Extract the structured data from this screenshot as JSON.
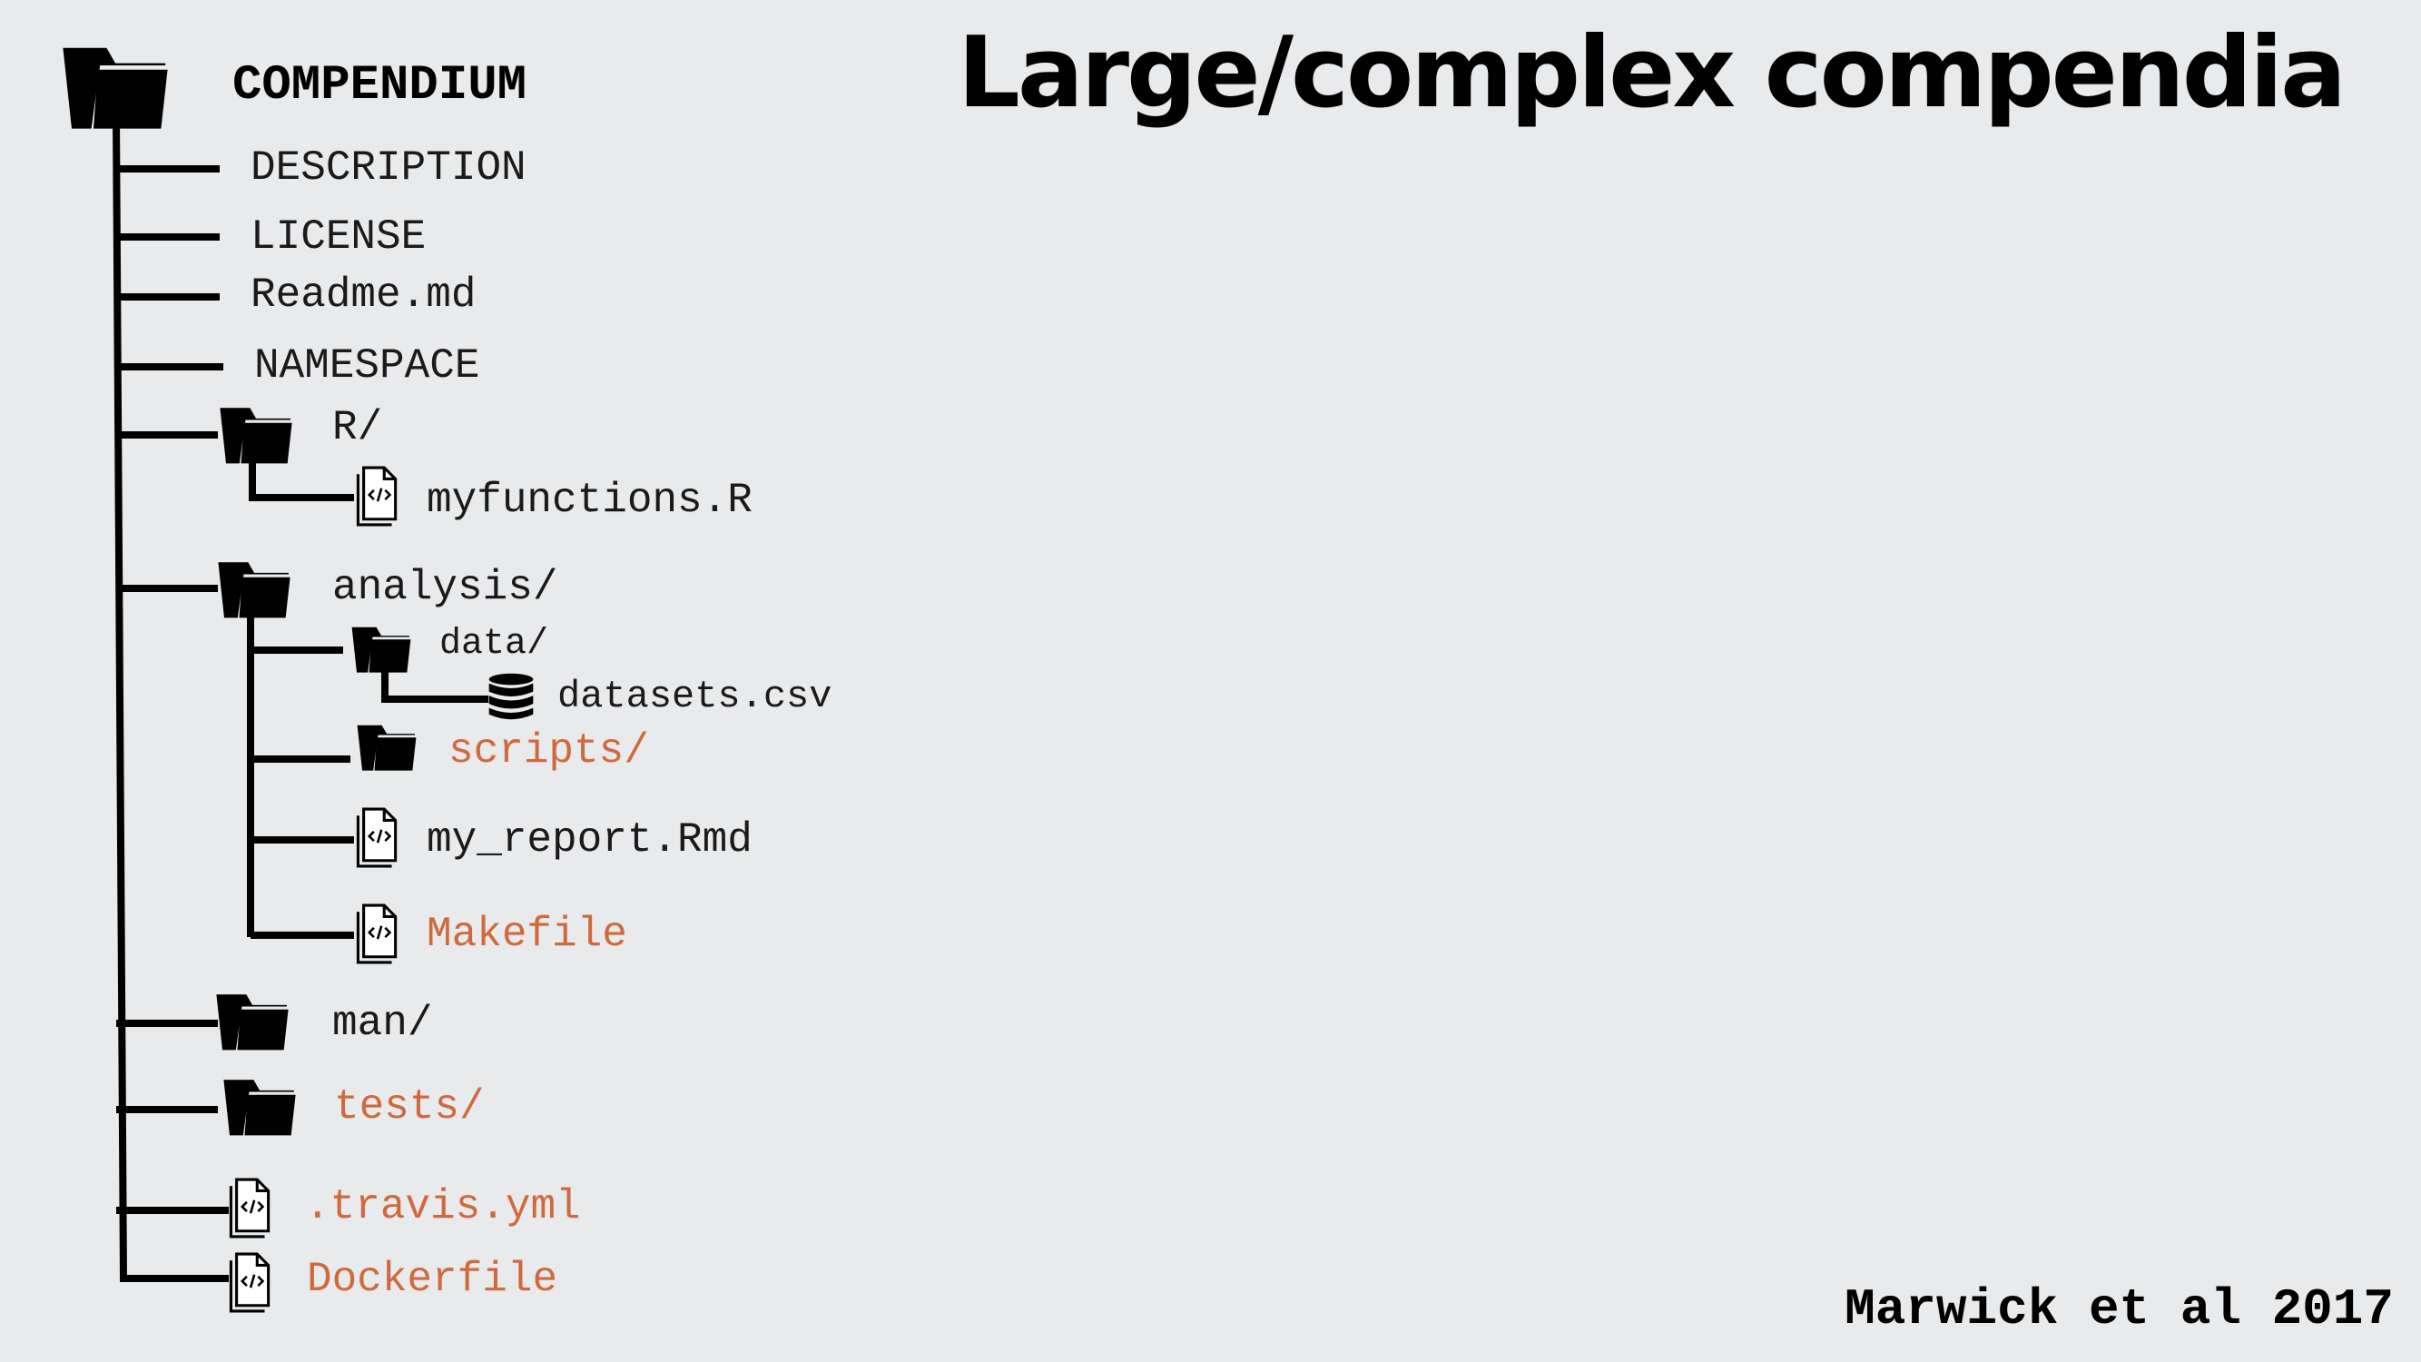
{
  "title": "Large/complex compendia",
  "citation": "Marwick et al 2017",
  "tree": {
    "root": {
      "label": "COMPENDIUM",
      "icon": "folder-icon"
    },
    "items": [
      {
        "label": "DESCRIPTION",
        "icon": "none",
        "highlight": false
      },
      {
        "label": "LICENSE",
        "icon": "none",
        "highlight": false
      },
      {
        "label": "Readme.md",
        "icon": "none",
        "highlight": false
      },
      {
        "label": "NAMESPACE",
        "icon": "none",
        "highlight": false
      },
      {
        "label": "R/",
        "icon": "folder-icon",
        "highlight": false
      },
      {
        "label": "myfunctions.R",
        "icon": "code-file-icon",
        "highlight": false
      },
      {
        "label": "analysis/",
        "icon": "folder-icon",
        "highlight": false
      },
      {
        "label": "data/",
        "icon": "folder-icon",
        "highlight": false
      },
      {
        "label": "datasets.csv",
        "icon": "database-icon",
        "highlight": false
      },
      {
        "label": "scripts/",
        "icon": "folder-icon",
        "highlight": true
      },
      {
        "label": "my_report.Rmd",
        "icon": "code-file-icon",
        "highlight": false
      },
      {
        "label": "Makefile",
        "icon": "code-file-icon",
        "highlight": true
      },
      {
        "label": "man/",
        "icon": "folder-icon",
        "highlight": false
      },
      {
        "label": "tests/",
        "icon": "folder-icon",
        "highlight": true
      },
      {
        "label": ".travis.yml",
        "icon": "code-file-icon",
        "highlight": true
      },
      {
        "label": "Dockerfile",
        "icon": "code-file-icon",
        "highlight": true
      }
    ]
  },
  "colors": {
    "highlight": "#cf6a3e",
    "text": "#1a1a1a",
    "background": "#e9eaec"
  }
}
